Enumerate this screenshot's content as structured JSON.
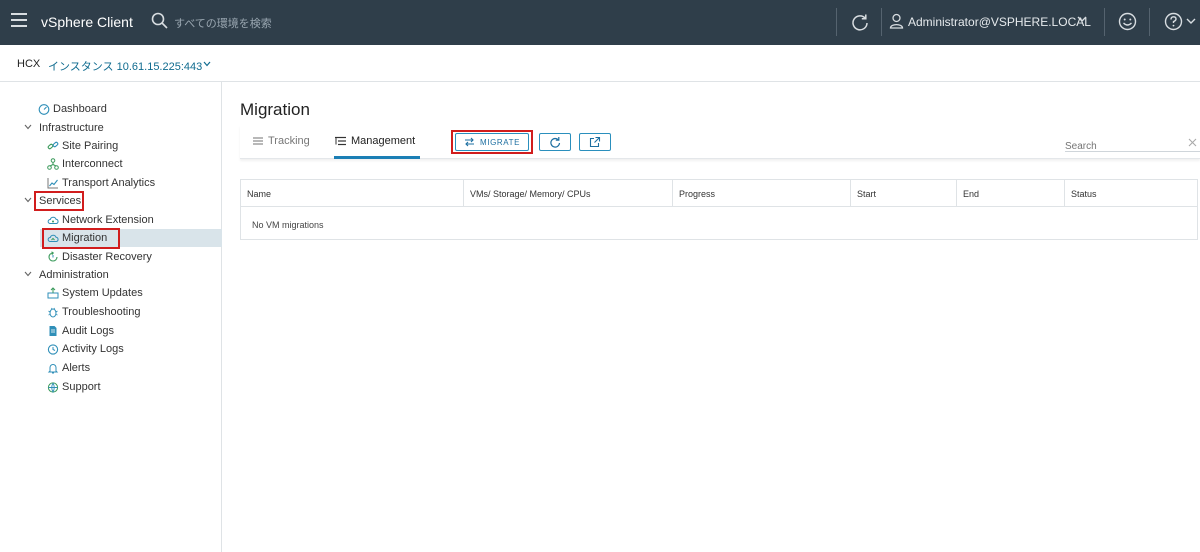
{
  "header": {
    "app_title": "vSphere Client",
    "search_placeholder": "すべての環境を検索",
    "user": "Administrator@VSPHERE.LOCAL",
    "colors": {
      "background": "#2f3e4a",
      "accent": "#1b7fb5",
      "highlight": "#d11d1d"
    }
  },
  "subheader": {
    "brand": "HCX",
    "instance": "インスタンス 10.61.15.225:443"
  },
  "sidebar": {
    "dashboard": "Dashboard",
    "infrastructure": {
      "label": "Infrastructure",
      "items": [
        "Site Pairing",
        "Interconnect",
        "Transport Analytics"
      ]
    },
    "services": {
      "label": "Services",
      "items": [
        "Network Extension",
        "Migration",
        "Disaster Recovery"
      ]
    },
    "administration": {
      "label": "Administration",
      "items": [
        "System Updates",
        "Troubleshooting",
        "Audit Logs",
        "Activity Logs",
        "Alerts",
        "Support"
      ]
    },
    "active_item": "Migration"
  },
  "main": {
    "title": "Migration",
    "tabs": [
      {
        "label": "Tracking",
        "active": false
      },
      {
        "label": "Management",
        "active": true
      }
    ],
    "migrate_button": "MIGRATE",
    "search_placeholder": "Search",
    "table": {
      "columns": [
        "Name",
        "VMs/ Storage/ Memory/ CPUs",
        "Progress",
        "Start",
        "End",
        "Status"
      ],
      "empty_message": "No VM migrations"
    }
  }
}
